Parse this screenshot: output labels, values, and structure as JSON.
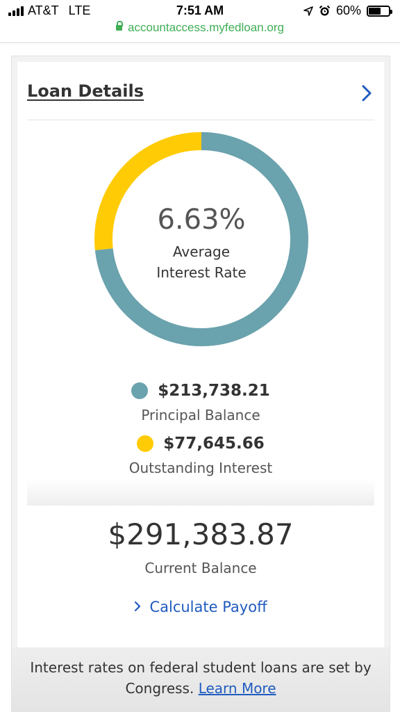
{
  "status_bar": {
    "carrier": "AT&T",
    "network": "LTE",
    "time": "7:51 AM",
    "battery": "60%",
    "battery_level": 0.6
  },
  "browser": {
    "url": "accountaccess.myfedloan.org"
  },
  "loan_details": {
    "title": "Loan Details",
    "rate": "6.63%",
    "rate_label_line1": "Average",
    "rate_label_line2": "Interest Rate",
    "principal_amount": "$213,738.21",
    "principal_label": "Principal Balance",
    "interest_amount": "$77,645.66",
    "interest_label": "Outstanding Interest",
    "total_amount": "$291,383.87",
    "total_label": "Current Balance",
    "payoff_link": "Calculate Payoff"
  },
  "chart_data": {
    "type": "pie",
    "categories": [
      "Principal Balance",
      "Outstanding Interest"
    ],
    "values": [
      213738.21,
      77645.66
    ],
    "colors": [
      "#6aa2ad",
      "#ffcb05"
    ]
  },
  "footer": {
    "text": "Interest rates on federal student loans are set by Congress.",
    "link": "Learn More"
  },
  "colors": {
    "principal": "#6aa2ad",
    "interest": "#ffcb05",
    "link": "#1f5bbf"
  }
}
